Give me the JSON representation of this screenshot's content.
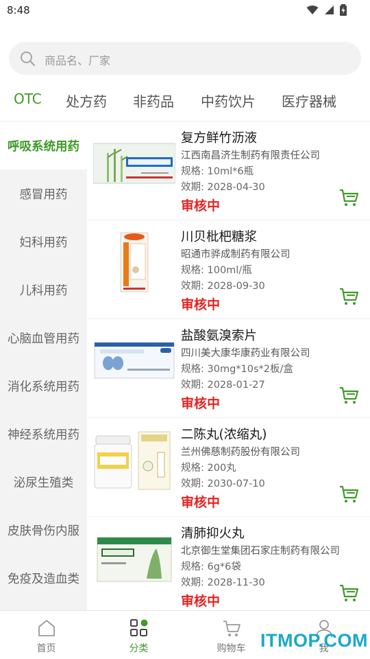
{
  "status_bar": {
    "time": "8:48"
  },
  "search": {
    "placeholder": "商品名、厂家"
  },
  "category_tabs": [
    "OTC",
    "处方药",
    "非药品",
    "中药饮片",
    "医疗器械"
  ],
  "sidebar": [
    "呼吸系统用药",
    "感冒用药",
    "妇科用药",
    "儿科用药",
    "心脑血管用药",
    "消化系统用药",
    "神经系统用药",
    "泌尿生殖类",
    "皮肤骨伤内服",
    "免疫及造血类"
  ],
  "products": [
    {
      "name": "复方鲜竹沥液",
      "maker": "江西南昌济生制药有限责任公司",
      "spec": "规格: 10ml*6瓶",
      "expiry": "效期: 2028-04-30",
      "status": "审核中"
    },
    {
      "name": "川贝枇杷糖浆",
      "maker": "昭通市骅成制药有限公司",
      "spec": "规格: 100ml/瓶",
      "expiry": "效期: 2028-09-30",
      "status": "审核中"
    },
    {
      "name": "盐酸氨溴索片",
      "maker": "四川美大康华康药业有限公司",
      "spec": "规格: 30mg*10s*2板/盒",
      "expiry": "效期: 2028-01-27",
      "status": "审核中"
    },
    {
      "name": "二陈丸(浓缩丸)",
      "maker": "兰州佛慈制药股份有限公司",
      "spec": "规格: 200丸",
      "expiry": "效期: 2030-07-10",
      "status": "审核中"
    },
    {
      "name": "清肺抑火丸",
      "maker": "北京御生堂集团石家庄制药有限公司",
      "spec": "规格: 6g*6袋",
      "expiry": "效期: 2028-11-30",
      "status": "审核中"
    }
  ],
  "bottom_nav": [
    "首页",
    "分类",
    "购物车",
    "我"
  ],
  "watermark": "ITMOP.COM",
  "colors": {
    "accent": "#3f9a27",
    "status_red": "#e52222",
    "watermark": "#1aa9c9"
  }
}
